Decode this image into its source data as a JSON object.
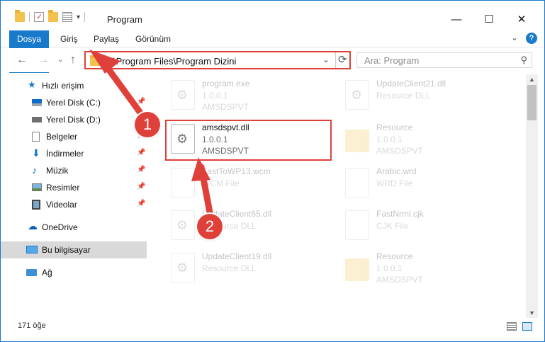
{
  "titlebar": {
    "title": "Program",
    "minimize": "—",
    "maximize": "☐",
    "close": "✕"
  },
  "ribbon": {
    "tabs": [
      "Dosya",
      "Giriş",
      "Paylaş",
      "Görünüm"
    ],
    "expand": "⌄",
    "help": "?"
  },
  "nav": {
    "back": "←",
    "forward": "→",
    "recent": "⌄",
    "up": "↑"
  },
  "address": {
    "path": "C:\\Program Files\\Program Dizini",
    "dropdown": "⌄",
    "refresh": "⟳"
  },
  "search": {
    "placeholder": "Ara: Program",
    "icon": "search-icon"
  },
  "sidebar": {
    "items": [
      {
        "label": "Hızlı erişim",
        "icon": "star-icon"
      },
      {
        "label": "Yerel Disk (C:)",
        "icon": "drive-icon"
      },
      {
        "label": "Yerel Disk (D:)",
        "icon": "drive-icon"
      },
      {
        "label": "Belgeler",
        "icon": "documents-icon"
      },
      {
        "label": "İndirmeler",
        "icon": "download-icon"
      },
      {
        "label": "Müzik",
        "icon": "music-icon"
      },
      {
        "label": "Resimler",
        "icon": "pictures-icon"
      },
      {
        "label": "Videolar",
        "icon": "video-icon"
      },
      {
        "label": "OneDrive",
        "icon": "cloud-icon"
      },
      {
        "label": "Bu bilgisayar",
        "icon": "computer-icon"
      },
      {
        "label": "Ağ",
        "icon": "network-icon"
      }
    ],
    "pin": "📌"
  },
  "files": [
    {
      "name": "program.exe",
      "line1": "1.0.0.1",
      "line2": "AMSDSPVT",
      "icon": "exe-icon",
      "faded": true
    },
    {
      "name": "UpdateClient21.dll",
      "line1": "Resource DLL",
      "line2": "",
      "icon": "dll-icon",
      "faded": true
    },
    {
      "name": "amsdspvt.dll",
      "line1": "1.0.0.1",
      "line2": "AMSDSPVT",
      "icon": "dll-icon",
      "faded": false
    },
    {
      "name": "Resource",
      "line1": "1.0.0.1",
      "line2": "AMSDSPVT",
      "icon": "folder-icon",
      "faded": true
    },
    {
      "name": "FastToWP13.wcm",
      "line1": "WCM File",
      "line2": "",
      "icon": "file-icon",
      "faded": true
    },
    {
      "name": "Arabic.wrd",
      "line1": "WRD File",
      "line2": "",
      "icon": "file-icon",
      "faded": true
    },
    {
      "name": "UpdateClient65.dll",
      "line1": "Resource DLL",
      "line2": "",
      "icon": "dll-icon",
      "faded": true
    },
    {
      "name": "FastNrml.cjk",
      "line1": "CJK File",
      "line2": "",
      "icon": "file-icon",
      "faded": true
    },
    {
      "name": "UpdateClient19.dll",
      "line1": "Resource DLL",
      "line2": "",
      "icon": "dll-icon",
      "faded": true
    },
    {
      "name": "Resource",
      "line1": "1.0.0.1",
      "line2": "AMSDSPVT",
      "icon": "folder-icon",
      "faded": true
    }
  ],
  "status": {
    "count": "171 öğe"
  },
  "callouts": [
    "1",
    "2"
  ],
  "colors": {
    "accent": "#1979ca",
    "callout": "#e0403a",
    "selection": "#d9d9d9"
  }
}
